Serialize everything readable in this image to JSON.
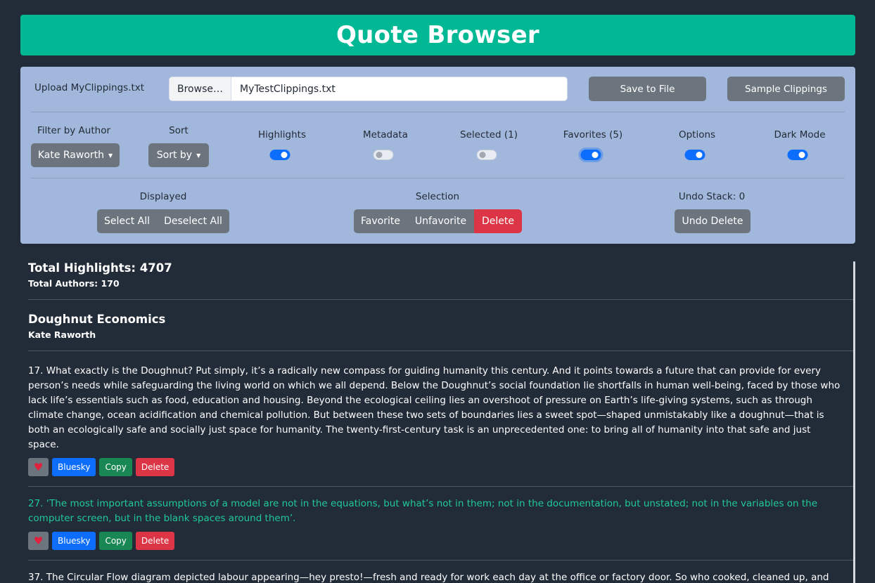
{
  "app": {
    "title": "Quote Browser"
  },
  "upload": {
    "label": "Upload MyClippings.txt",
    "browse_label": "Browse…",
    "file_name": "MyTestClippings.txt",
    "save_label": "Save to File",
    "sample_label": "Sample Clippings"
  },
  "controls": {
    "filter_label": "Filter by Author",
    "filter_value": "Kate Raworth",
    "sort_label": "Sort",
    "sort_value": "Sort by",
    "toggles": [
      {
        "label": "Highlights",
        "on": true
      },
      {
        "label": "Metadata",
        "on": false
      },
      {
        "label": "Selected (1)",
        "on": false
      },
      {
        "label": "Favorites (5)",
        "on": true
      },
      {
        "label": "Options",
        "on": true
      },
      {
        "label": "Dark Mode",
        "on": true
      }
    ]
  },
  "bulk": {
    "displayed_label": "Displayed",
    "select_all": "Select All",
    "deselect_all": "Deselect All",
    "selection_label": "Selection",
    "favorite": "Favorite",
    "unfavorite": "Unfavorite",
    "delete": "Delete",
    "undo_label": "Undo Stack: 0",
    "undo_button": "Undo Delete"
  },
  "summary": {
    "total_highlights": "Total Highlights: 4707",
    "total_authors": "Total Authors: 170"
  },
  "book": {
    "title": "Doughnut Economics",
    "author": "Kate Raworth"
  },
  "quotes": [
    {
      "text": "17. What exactly is the Doughnut? Put simply, it’s a radically new compass for guiding humanity this century. And it points towards a future that can provide for every person’s needs while safeguarding the living world on which we all depend. Below the Doughnut’s social foundation lie shortfalls in human well-being, faced by those who lack life’s essentials such as food, education and housing. Beyond the ecological ceiling lies an overshoot of pressure on Earth’s life-giving systems, such as through climate change, ocean acidification and chemical pollution. But between these two sets of boundaries lies a sweet spot—shaped unmistakably like a doughnut—that is both an ecologically safe and socially just space for humanity. The twenty-first-century task is an unprecedented one: to bring all of humanity into that safe and just space.",
      "selected": false
    },
    {
      "text": "27. ‘The most important assumptions of a model are not in the equations, but what’s not in them; not in the documentation, but unstated; not in the variables on the computer screen, but in the blank spaces around them’.",
      "selected": true
    },
    {
      "text": "37. The Circular Flow diagram depicted labour appearing—hey presto!—fresh and ready for work each day at the office or factory door. So who cooked, cleaned up, and cleared",
      "selected": false
    }
  ],
  "quote_actions": {
    "favorite_icon": "heart-icon",
    "bluesky": "Bluesky",
    "copy": "Copy",
    "delete": "Delete"
  },
  "colors": {
    "background": "#222b38",
    "header": "#00b894",
    "panel": "#a1b8dc",
    "selected_quote": "#20c997",
    "primary": "#0d6efd",
    "danger": "#dc3545",
    "success": "#198754"
  }
}
